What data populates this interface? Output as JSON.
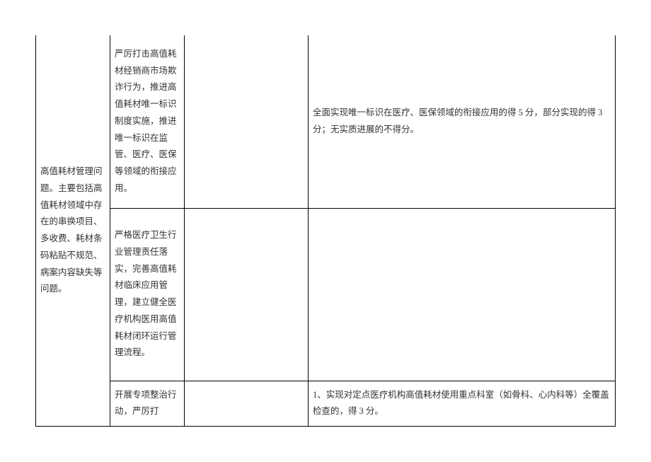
{
  "table": {
    "col1_merged": "高值耗材管理问题。主要包括高值耗材领域中存在的串换项目、多收费、耗材条码粘贴不规范、病案内容缺失等问题。",
    "rows": [
      {
        "col2": "严厉打击高值耗材经销商市场欺诈行为，推进高值耗材唯一标识制度实施，推进唯一标识在监管、医疗、医保等领域的衔接应用。",
        "col3": "",
        "col4": "全面实现唯一标识在医疗、医保领域的衔接应用的得 5 分，部分实现的得 3 分；无实质进展的不得分。"
      },
      {
        "col2": "严格医疗卫生行业管理责任落实，完善高值耗材临床应用管理，建立健全医疗机构医用高值耗材闭环运行管理流程。",
        "col3": "",
        "col4": ""
      },
      {
        "col2": "开展专项整治行动，严厉打",
        "col3": "",
        "col4": "1、实现对定点医疗机构高值耗材使用重点科室（如骨科、心内科等）全覆盖检查的，得 3 分。"
      }
    ]
  }
}
